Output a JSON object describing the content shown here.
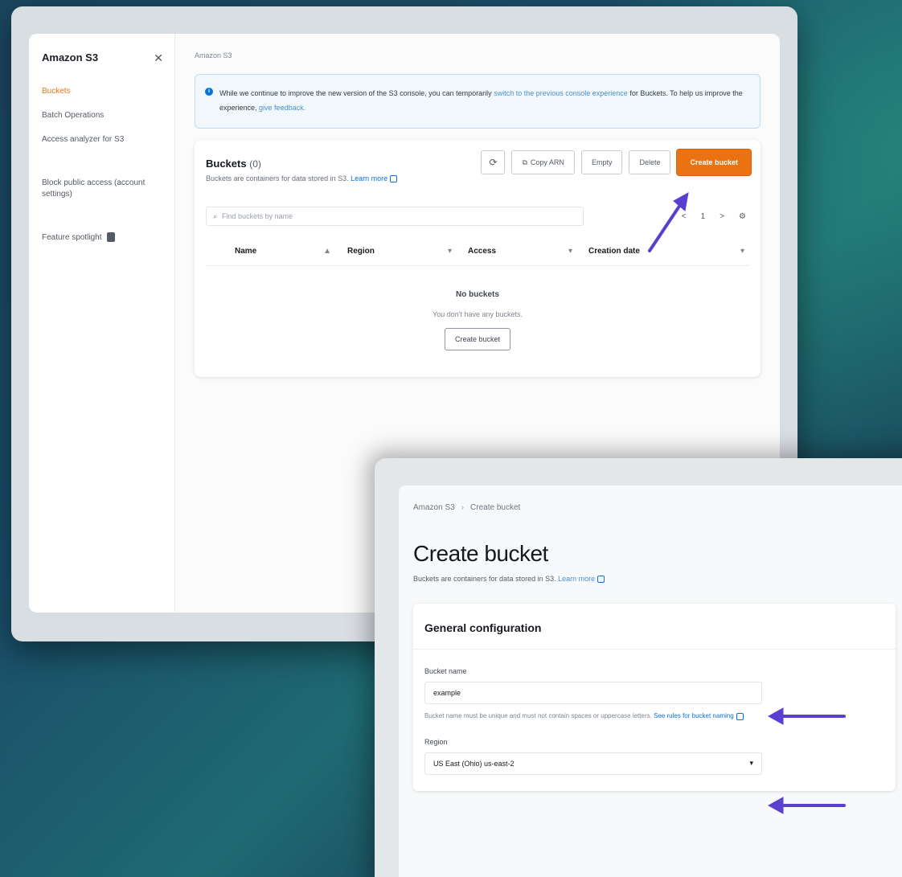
{
  "colors": {
    "accent_orange": "#ec7211",
    "link_blue": "#0972d3",
    "annotation_arrow": "#5b3fd0"
  },
  "win1": {
    "sidebar": {
      "title": "Amazon S3",
      "close_icon": "close-icon",
      "items": [
        {
          "label": "Buckets",
          "active": true
        },
        {
          "label": "Batch Operations",
          "active": false
        },
        {
          "label": "Access analyzer for S3",
          "active": false
        }
      ],
      "block_public_label": "Block public access (account settings)",
      "feature_spotlight": "Feature spotlight"
    },
    "breadcrumb": "Amazon S3",
    "info_banner": {
      "text": "While we continue to improve the new version of the S3 console, you can temporarily",
      "link": "switch to the previous console experience",
      "text2": "for Buckets. To help us improve the experience,",
      "link2": "give feedback."
    },
    "buckets": {
      "title": "Buckets",
      "count": "(0)",
      "description": "Buckets are containers for data stored in S3.",
      "learn_more": "Learn more",
      "actions": {
        "refresh_icon": "refresh-icon",
        "copy_arn": "Copy ARN",
        "empty": "Empty",
        "delete": "Delete",
        "create": "Create bucket"
      },
      "search_placeholder": "Find buckets by name",
      "pager": {
        "prev": "<",
        "page": "1",
        "next": ">",
        "settings_icon": "gear-icon"
      },
      "columns": [
        "Name",
        "Region",
        "Access",
        "Creation date"
      ],
      "empty_title": "No buckets",
      "empty_desc": "You don't have any buckets.",
      "empty_button": "Create bucket"
    }
  },
  "win2": {
    "breadcrumb": [
      "Amazon S3",
      "Create bucket"
    ],
    "title": "Create bucket",
    "description": "Buckets are containers for data stored in S3.",
    "learn_more": "Learn more",
    "general_config": {
      "title": "General configuration",
      "bucket_name_label": "Bucket name",
      "bucket_name_value": "example",
      "bucket_name_hint": "Bucket name must be unique and must not contain spaces or uppercase letters.",
      "bucket_name_hint_link": "See rules for bucket naming",
      "region_label": "Region",
      "region_value": "US East (Ohio) us-east-2"
    }
  }
}
